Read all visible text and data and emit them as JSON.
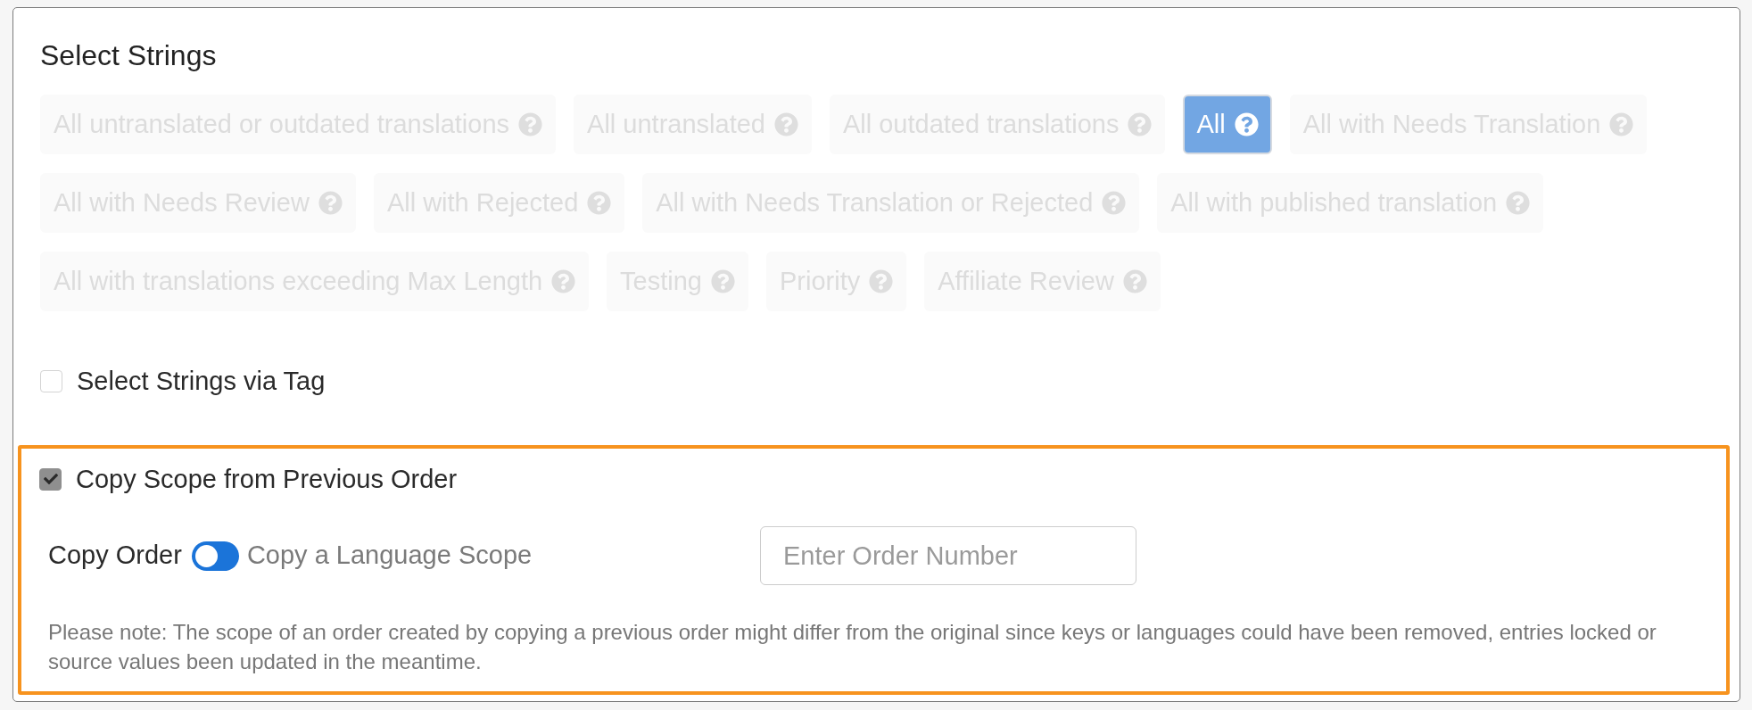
{
  "section": {
    "title": "Select Strings",
    "filters": [
      {
        "label": "All untranslated or outdated translations",
        "selected": false
      },
      {
        "label": "All untranslated",
        "selected": false
      },
      {
        "label": "All outdated translations",
        "selected": false
      },
      {
        "label": "All",
        "selected": true
      },
      {
        "label": "All with Needs Translation",
        "selected": false
      },
      {
        "label": "All with Needs Review",
        "selected": false
      },
      {
        "label": "All with Rejected",
        "selected": false
      },
      {
        "label": "All with Needs Translation or Rejected",
        "selected": false
      },
      {
        "label": "All with published translation",
        "selected": false
      },
      {
        "label": "All with translations exceeding Max Length",
        "selected": false
      },
      {
        "label": "Testing",
        "selected": false
      },
      {
        "label": "Priority",
        "selected": false
      },
      {
        "label": "Affiliate Review",
        "selected": false
      }
    ]
  },
  "tag_option": {
    "label": "Select Strings via Tag",
    "checked": false
  },
  "copy_scope": {
    "label": "Copy Scope from Previous Order",
    "checked": true,
    "mode_options": [
      {
        "label": "Copy Order",
        "selected": true
      },
      {
        "label": "Copy a Language Scope",
        "selected": false
      }
    ],
    "order_field": {
      "placeholder": "Enter Order Number"
    },
    "note": "Please note: The scope of an order created by copying a previous order might differ from the original since keys or languages could have been removed, entries locked or source values been updated in the meantime."
  }
}
